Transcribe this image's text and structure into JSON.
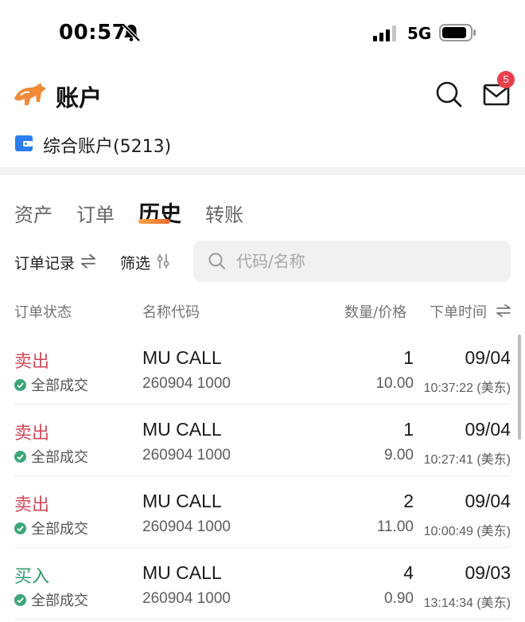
{
  "status_bar": {
    "time": "00:57",
    "network": "5G",
    "icons": [
      "bell-slash-icon",
      "signal-icon",
      "battery-icon"
    ]
  },
  "header": {
    "title": "账户",
    "mail_badge_count": "5",
    "icons": [
      "bull-logo-icon",
      "search-icon",
      "mail-icon"
    ]
  },
  "account": {
    "name": "综合账户(5213)",
    "accent": "#2a7cf0"
  },
  "tabs": [
    {
      "label": "资产",
      "active": false
    },
    {
      "label": "订单",
      "active": false
    },
    {
      "label": "历史",
      "active": true
    },
    {
      "label": "转账",
      "active": false
    }
  ],
  "filters": {
    "order_record_label": "订单记录",
    "filter_label": "筛选",
    "search_placeholder": "代码/名称"
  },
  "columns": {
    "status": "订单状态",
    "name_code": "名称代码",
    "qty_price": "数量/价格",
    "order_time": "下单时间"
  },
  "colors": {
    "sell": "#d34a5a",
    "buy": "#2f9a6a",
    "badge": "#e6404c",
    "tab_underline": "#ee6b2e"
  },
  "orders": [
    {
      "side": "卖出",
      "side_type": "sell",
      "status": "全部成交",
      "name": "MU CALL",
      "code": "260904 1000",
      "qty": "1",
      "price": "10.00",
      "date": "09/04",
      "time": "10:37:22 (美东)"
    },
    {
      "side": "卖出",
      "side_type": "sell",
      "status": "全部成交",
      "name": "MU CALL",
      "code": "260904 1000",
      "qty": "1",
      "price": "9.00",
      "date": "09/04",
      "time": "10:27:41 (美东)"
    },
    {
      "side": "卖出",
      "side_type": "sell",
      "status": "全部成交",
      "name": "MU CALL",
      "code": "260904 1000",
      "qty": "2",
      "price": "11.00",
      "date": "09/04",
      "time": "10:00:49 (美东)"
    },
    {
      "side": "买入",
      "side_type": "buy",
      "status": "全部成交",
      "name": "MU CALL",
      "code": "260904 1000",
      "qty": "4",
      "price": "0.90",
      "date": "09/03",
      "time": "13:14:34 (美东)"
    }
  ]
}
